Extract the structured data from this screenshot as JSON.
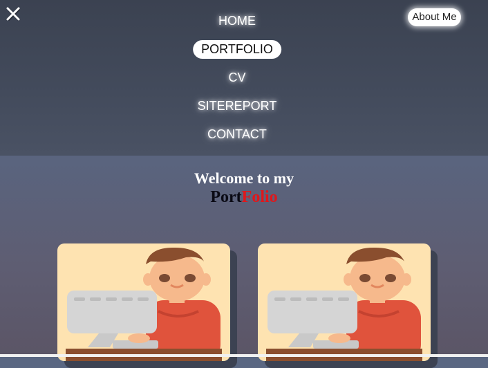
{
  "close_icon": "close-x-icon",
  "nav": {
    "items": [
      {
        "label": "HOME"
      },
      {
        "label": "PORTFOLIO"
      },
      {
        "label": "CV"
      },
      {
        "label": "SITEREPORT"
      },
      {
        "label": "CONTACT"
      }
    ]
  },
  "about_button": {
    "label": "About Me"
  },
  "hero": {
    "welcome": "Welcome to my",
    "brand_part1": "Port",
    "brand_part2": "Folio"
  },
  "colors": {
    "brand_red": "#e0171b",
    "card_background": "#fee3b1",
    "header_background": "#3b4251"
  },
  "cards": [
    {
      "illustration": "person-at-computer-icon"
    },
    {
      "illustration": "person-at-computer-icon"
    }
  ]
}
